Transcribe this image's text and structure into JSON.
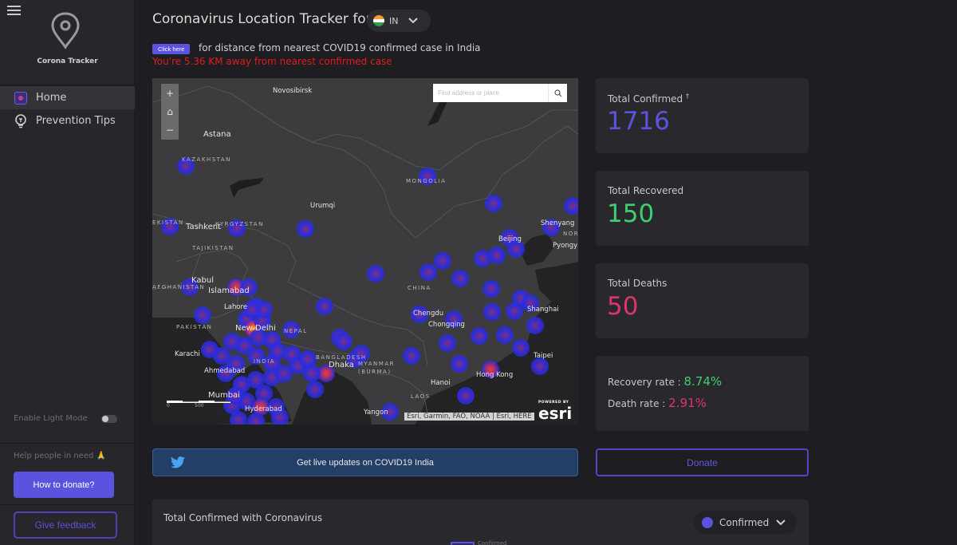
{
  "sidebar": {
    "brand": "Corona Tracker",
    "nav": [
      {
        "label": "Home",
        "icon": "home-map-icon",
        "active": true
      },
      {
        "label": "Prevention Tips",
        "icon": "lightbulb-icon",
        "active": false
      }
    ],
    "light_mode_label": "Enable Light Mode",
    "light_mode_enabled": false,
    "help_text": "Help people in need 🙏",
    "how_to_donate_label": "How to donate?",
    "feedback_label": "Give feedback"
  },
  "header": {
    "title": "Coronavirus Location Tracker for",
    "country_code": "IN",
    "click_here_label": "Click here",
    "distance_prompt": "for distance from nearest COVID19 confirmed case in India",
    "distance_result": "You're 5.36 KM away from nearest confirmed case"
  },
  "map": {
    "search_placeholder": "Find address or place",
    "zoom_in": "+",
    "home": "⌂",
    "zoom_out": "−",
    "attribution": "Esri, Garmin, FAO, NOAA | Esri, HERE",
    "esri_powered": "POWERED BY",
    "esri_brand": "esri",
    "scale_labels": [
      "0",
      "500"
    ],
    "labels": {
      "novosibirsk": "Novosibirsk",
      "astana": "Astana",
      "kazakhstan": "KAZAKHSTAN",
      "urumqi": "Urumqi",
      "mongolia": "MONGOLIA",
      "tashkent": "Tashkent",
      "kyrgyzstan": "KYRGYZSTAN",
      "tajikistan": "TAJIKISTAN",
      "uzbekistan": "EKISTAN",
      "afghanistan": "AFGHANISTAN",
      "kabul": "Kabul",
      "islamabad": "Islamabad",
      "lahore": "Lahore",
      "pakistan": "PAKISTAN",
      "new_delhi": "New Delhi",
      "nepal": "NEPAL",
      "karachi": "Karachi",
      "india": "INDIA",
      "ahmedabad": "Ahmedabad",
      "mumbai": "Mumbai",
      "hyderabad": "Hyderabad",
      "bangladesh": "BANGLADESH",
      "dhaka": "Dhaka",
      "myanmar": "MYANMAR",
      "burma": "(BURMA)",
      "yangon": "Yangon",
      "laos": "LAOS",
      "hanoi": "Hanoi",
      "china": "CHINA",
      "chengdu": "Chengdu",
      "chongqing": "Chongqing",
      "beijing": "Beijing",
      "shenyang": "Shenyang",
      "north_korea": "NORTH KOREA",
      "pyongyang": "Pyongy",
      "shanghai": "Shanghai",
      "hong_kong": "Hong Kong",
      "taipei": "Taipei"
    }
  },
  "stats": {
    "confirmed_label": "Total Confirmed",
    "confirmed_mark": "†",
    "confirmed": "1716",
    "recovered_label": "Total Recovered",
    "recovered": "150",
    "deaths_label": "Total Deaths",
    "deaths": "50",
    "recovery_rate_label": "Recovery rate :",
    "recovery_rate": "8.74%",
    "death_rate_label": "Death rate :",
    "death_rate": "2.91%"
  },
  "colors": {
    "accent": "#5b52e0",
    "confirmed": "#5b52e0",
    "recovered": "#3ecf6e",
    "deaths": "#e0336b",
    "alert": "#e11b1b",
    "twitter": "#243f66"
  },
  "actions": {
    "twitter_label": "Get live updates on COVID19 India",
    "donate_label": "Donate"
  },
  "chart_section": {
    "title": "Total Confirmed with Coronavirus",
    "metric": "Confirmed",
    "legend": "Confirmed"
  }
}
